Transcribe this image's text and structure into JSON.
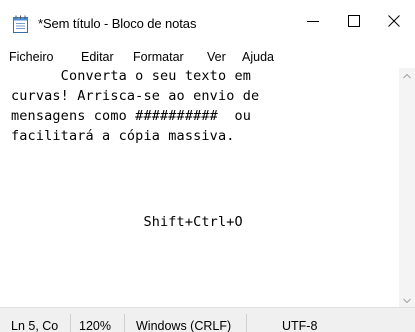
{
  "window": {
    "title": "*Sem título - Bloco de notas",
    "icon": "notepad-icon",
    "controls": {
      "minimize_icon": "minimize-icon",
      "maximize_icon": "maximize-icon",
      "close_icon": "close-icon"
    }
  },
  "menu": {
    "items": [
      {
        "label": "Ficheiro"
      },
      {
        "label": "Editar"
      },
      {
        "label": "Formatar"
      },
      {
        "label": "Ver"
      },
      {
        "label": "Ajuda"
      }
    ]
  },
  "editor": {
    "lines": [
      "      Converta o seu texto em",
      "curvas! Arrisca-se ao envio de",
      "mensagens como ##########  ou",
      "facilitará a cópia massiva.",
      "                Shift+Ctrl+O"
    ]
  },
  "status": {
    "position": "Ln 5, Co",
    "zoom": "120%",
    "line_ending": "Windows (CRLF)",
    "encoding": "UTF-8"
  }
}
